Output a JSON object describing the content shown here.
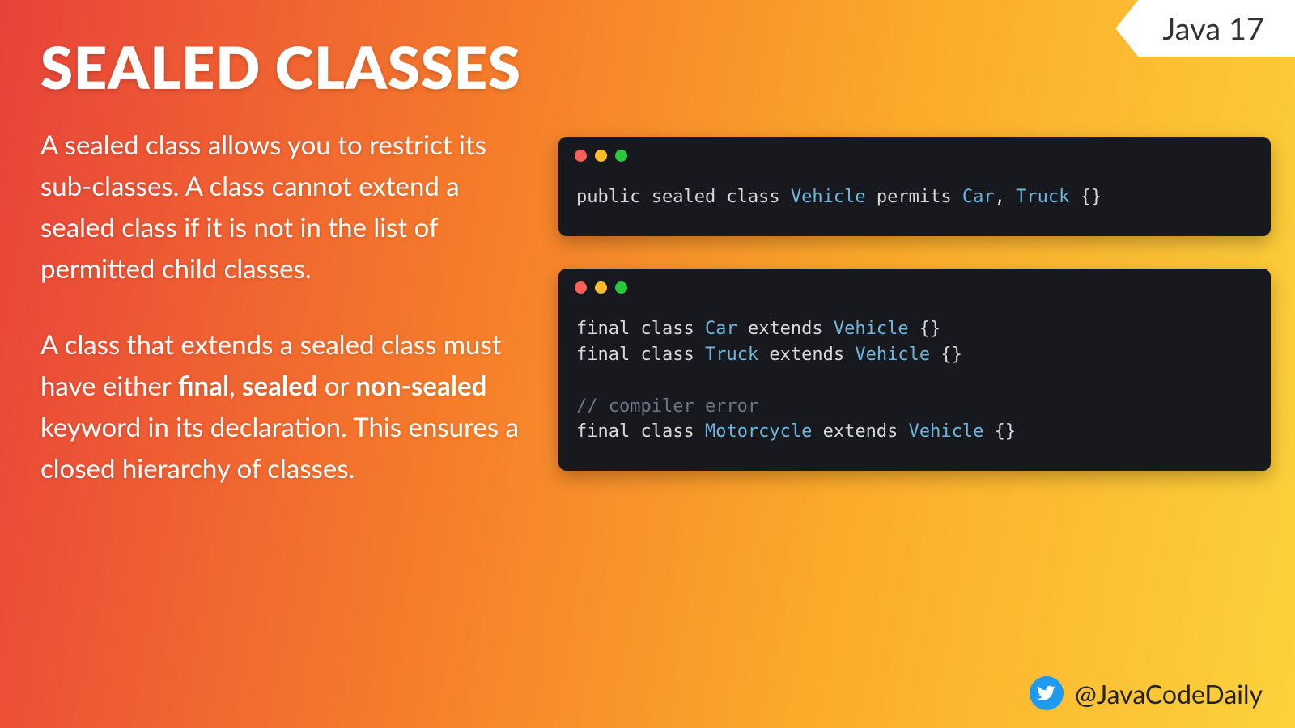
{
  "badge": "Java 17",
  "title": "SEALED CLASSES",
  "paragraphs": {
    "p1": "A sealed class allows you to restrict its sub-classes. A class cannot extend a sealed class if it is not in the list of permitted child classes.",
    "p2_pre": "A class that extends a sealed class must have either ",
    "p2_b1": "final",
    "p2_sep1": ", ",
    "p2_b2": "sealed",
    "p2_sep2": " or ",
    "p2_b3": "non-sealed",
    "p2_post": " keyword in its declaration. This ensures a closed hierarchy of classes."
  },
  "code1": {
    "t1": "public sealed class ",
    "c1": "Vehicle",
    "t2": " permits ",
    "c2": "Car",
    "t3": ", ",
    "c3": "Truck",
    "t4": " {}"
  },
  "code2": {
    "l1a": "final class ",
    "l1b": "Car",
    "l1c": " extends ",
    "l1d": "Vehicle",
    "l1e": " {}",
    "l2a": "final class ",
    "l2b": "Truck",
    "l2c": " extends ",
    "l2d": "Vehicle",
    "l2e": " {}",
    "blank": "",
    "l3": "// compiler error",
    "l4a": "final class ",
    "l4b": "Motorcycle",
    "l4c": " extends ",
    "l4d": "Vehicle",
    "l4e": " {}"
  },
  "footer": {
    "handle": "@JavaCodeDaily"
  }
}
